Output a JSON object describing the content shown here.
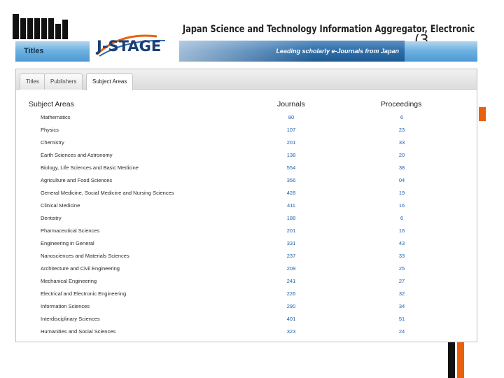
{
  "slide": {
    "number": "(3",
    "accent_color": "#e8620e"
  },
  "header": {
    "section_label": "Titles",
    "logo_text": "J-STAGE",
    "site_title": "Japan Science and Technology Information Aggregator, Electronic",
    "tagline": "Leading scholarly e-Journals from Japan"
  },
  "tabs": [
    {
      "label": "Titles",
      "active": false
    },
    {
      "label": "Publishers",
      "active": false
    },
    {
      "label": "Subject Areas",
      "active": true
    }
  ],
  "table": {
    "headers": {
      "subject": "Subject Areas",
      "journals": "Journals",
      "proceedings": "Proceedings"
    },
    "rows": [
      {
        "subject": "Mathematics",
        "journals": "80",
        "proceedings": "6"
      },
      {
        "subject": "Physics",
        "journals": "107",
        "proceedings": "23"
      },
      {
        "subject": "Chemistry",
        "journals": "201",
        "proceedings": "33"
      },
      {
        "subject": "Earth Sciences and Astronomy",
        "journals": "138",
        "proceedings": "20"
      },
      {
        "subject": "Biology, Life Sciences and Basic Medicine",
        "journals": "554",
        "proceedings": "38"
      },
      {
        "subject": "Agriculture and Food Sciences",
        "journals": "356",
        "proceedings": "04"
      },
      {
        "subject": "General Medicine, Social Medicine and Nursing Sciences",
        "journals": "428",
        "proceedings": "19"
      },
      {
        "subject": "Clinical Medicine",
        "journals": "411",
        "proceedings": "16"
      },
      {
        "subject": "Dentistry",
        "journals": "188",
        "proceedings": "6"
      },
      {
        "subject": "Pharmaceutical Sciences",
        "journals": "201",
        "proceedings": "16"
      },
      {
        "subject": "Engineering in General",
        "journals": "331",
        "proceedings": "43"
      },
      {
        "subject": "Nanosciences and Materials Sciences",
        "journals": "237",
        "proceedings": "33"
      },
      {
        "subject": "Architecture and Civil Engineering",
        "journals": "209",
        "proceedings": "25"
      },
      {
        "subject": "Mechanical Engineering",
        "journals": "241",
        "proceedings": "27"
      },
      {
        "subject": "Electrical and Electronic Engineering",
        "journals": "226",
        "proceedings": "32"
      },
      {
        "subject": "Information Sciences",
        "journals": "290",
        "proceedings": "34"
      },
      {
        "subject": "Interdisciplinary Sciences",
        "journals": "401",
        "proceedings": "51"
      },
      {
        "subject": "Humanities and Social Sciences",
        "journals": "323",
        "proceedings": "24"
      }
    ]
  }
}
